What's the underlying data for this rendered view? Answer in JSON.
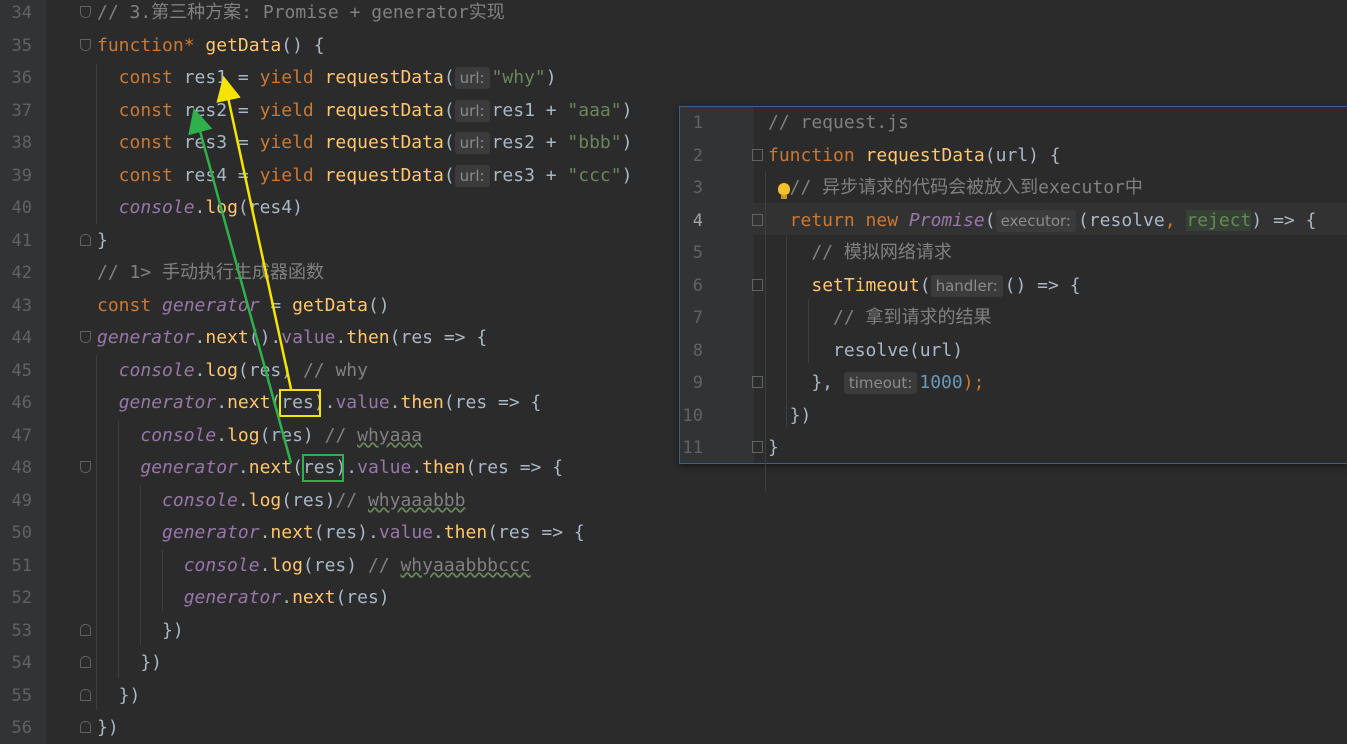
{
  "main_editor": {
    "lines": [
      {
        "num": "34",
        "tokens": [
          {
            "t": "// 3.第三种方案: Promise + generator实现",
            "c": "cm"
          }
        ]
      },
      {
        "num": "35",
        "tokens": [
          {
            "t": "function",
            "c": "kw"
          },
          {
            "t": "* ",
            "c": "kw"
          },
          {
            "t": "getData",
            "c": "fn"
          },
          {
            "t": "() {",
            "c": ""
          }
        ]
      },
      {
        "num": "36",
        "tokens": [
          {
            "t": "  const ",
            "c": "kw"
          },
          {
            "t": "res1 = ",
            "c": ""
          },
          {
            "t": "yield ",
            "c": "kw"
          },
          {
            "t": "requestData",
            "c": "fn"
          },
          {
            "t": "(",
            "c": ""
          },
          {
            "h": "url:"
          },
          {
            "t": "\"why\"",
            "c": "str"
          },
          {
            "t": ")",
            "c": ""
          }
        ]
      },
      {
        "num": "37",
        "tokens": [
          {
            "t": "  const ",
            "c": "kw"
          },
          {
            "t": "res2 = ",
            "c": ""
          },
          {
            "t": "yield ",
            "c": "kw"
          },
          {
            "t": "requestData",
            "c": "fn"
          },
          {
            "t": "(",
            "c": ""
          },
          {
            "h": "url:"
          },
          {
            "t": "res1 + ",
            "c": ""
          },
          {
            "t": "\"aaa\"",
            "c": "str"
          },
          {
            "t": ")",
            "c": ""
          }
        ]
      },
      {
        "num": "38",
        "tokens": [
          {
            "t": "  const ",
            "c": "kw"
          },
          {
            "t": "res3 = ",
            "c": ""
          },
          {
            "t": "yield ",
            "c": "kw"
          },
          {
            "t": "requestData",
            "c": "fn"
          },
          {
            "t": "(",
            "c": ""
          },
          {
            "h": "url:"
          },
          {
            "t": "res2 + ",
            "c": ""
          },
          {
            "t": "\"bbb\"",
            "c": "str"
          },
          {
            "t": ")",
            "c": ""
          }
        ]
      },
      {
        "num": "39",
        "tokens": [
          {
            "t": "  const ",
            "c": "kw"
          },
          {
            "t": "res4 = ",
            "c": ""
          },
          {
            "t": "yield ",
            "c": "kw"
          },
          {
            "t": "requestData",
            "c": "fn"
          },
          {
            "t": "(",
            "c": ""
          },
          {
            "h": "url:"
          },
          {
            "t": "res3 + ",
            "c": ""
          },
          {
            "t": "\"ccc\"",
            "c": "str"
          },
          {
            "t": ")",
            "c": ""
          }
        ]
      },
      {
        "num": "40",
        "tokens": [
          {
            "t": "  ",
            "c": ""
          },
          {
            "t": "console",
            "c": "ital"
          },
          {
            "t": ".",
            "c": ""
          },
          {
            "t": "log",
            "c": "fn"
          },
          {
            "t": "(res4)",
            "c": ""
          }
        ]
      },
      {
        "num": "41",
        "tokens": [
          {
            "t": "}",
            "c": ""
          }
        ]
      },
      {
        "num": "42",
        "tokens": [
          {
            "t": "// 1> 手动执行生成器函数",
            "c": "cm"
          }
        ]
      },
      {
        "num": "43",
        "tokens": [
          {
            "t": "const ",
            "c": "kw"
          },
          {
            "t": "generator",
            "c": "ital"
          },
          {
            "t": " = ",
            "c": ""
          },
          {
            "t": "getData",
            "c": "fn"
          },
          {
            "t": "()",
            "c": ""
          }
        ]
      },
      {
        "num": "44",
        "tokens": [
          {
            "t": "generator",
            "c": "ital"
          },
          {
            "t": ".",
            "c": ""
          },
          {
            "t": "next",
            "c": "fn"
          },
          {
            "t": "().",
            "c": ""
          },
          {
            "t": "value",
            "c": "prop"
          },
          {
            "t": ".",
            "c": ""
          },
          {
            "t": "then",
            "c": "fn"
          },
          {
            "t": "(res => {",
            "c": ""
          }
        ]
      },
      {
        "num": "45",
        "tokens": [
          {
            "t": "  ",
            "c": ""
          },
          {
            "t": "console",
            "c": "ital"
          },
          {
            "t": ".",
            "c": ""
          },
          {
            "t": "log",
            "c": "fn"
          },
          {
            "t": "(res) ",
            "c": ""
          },
          {
            "t": "// why",
            "c": "cm"
          }
        ]
      },
      {
        "num": "46",
        "tokens": [
          {
            "t": "  ",
            "c": ""
          },
          {
            "t": "generator",
            "c": "ital"
          },
          {
            "t": ".",
            "c": ""
          },
          {
            "t": "next",
            "c": "fn"
          },
          {
            "t": "(res).",
            "c": ""
          },
          {
            "t": "value",
            "c": "prop"
          },
          {
            "t": ".",
            "c": ""
          },
          {
            "t": "then",
            "c": "fn"
          },
          {
            "t": "(res => {",
            "c": ""
          }
        ]
      },
      {
        "num": "47",
        "tokens": [
          {
            "t": "    ",
            "c": ""
          },
          {
            "t": "console",
            "c": "ital"
          },
          {
            "t": ".",
            "c": ""
          },
          {
            "t": "log",
            "c": "fn"
          },
          {
            "t": "(res) ",
            "c": ""
          },
          {
            "t": "// ",
            "c": "cm"
          },
          {
            "t": "whyaaa",
            "c": "cm squig"
          }
        ]
      },
      {
        "num": "48",
        "tokens": [
          {
            "t": "    ",
            "c": ""
          },
          {
            "t": "generator",
            "c": "ital"
          },
          {
            "t": ".",
            "c": ""
          },
          {
            "t": "next",
            "c": "fn"
          },
          {
            "t": "(res).",
            "c": ""
          },
          {
            "t": "value",
            "c": "prop"
          },
          {
            "t": ".",
            "c": ""
          },
          {
            "t": "then",
            "c": "fn"
          },
          {
            "t": "(res => {",
            "c": ""
          }
        ]
      },
      {
        "num": "49",
        "tokens": [
          {
            "t": "      ",
            "c": ""
          },
          {
            "t": "console",
            "c": "ital"
          },
          {
            "t": ".",
            "c": ""
          },
          {
            "t": "log",
            "c": "fn"
          },
          {
            "t": "(res)",
            "c": ""
          },
          {
            "t": "// ",
            "c": "cm"
          },
          {
            "t": "whyaaabbb",
            "c": "cm squig"
          }
        ]
      },
      {
        "num": "50",
        "tokens": [
          {
            "t": "      ",
            "c": ""
          },
          {
            "t": "generator",
            "c": "ital"
          },
          {
            "t": ".",
            "c": ""
          },
          {
            "t": "next",
            "c": "fn"
          },
          {
            "t": "(res).",
            "c": ""
          },
          {
            "t": "value",
            "c": "prop"
          },
          {
            "t": ".",
            "c": ""
          },
          {
            "t": "then",
            "c": "fn"
          },
          {
            "t": "(res => {",
            "c": ""
          }
        ]
      },
      {
        "num": "51",
        "tokens": [
          {
            "t": "        ",
            "c": ""
          },
          {
            "t": "console",
            "c": "ital"
          },
          {
            "t": ".",
            "c": ""
          },
          {
            "t": "log",
            "c": "fn"
          },
          {
            "t": "(res) ",
            "c": ""
          },
          {
            "t": "// ",
            "c": "cm"
          },
          {
            "t": "whyaaabbbccc",
            "c": "cm squig"
          }
        ]
      },
      {
        "num": "52",
        "tokens": [
          {
            "t": "        ",
            "c": ""
          },
          {
            "t": "generator",
            "c": "ital"
          },
          {
            "t": ".",
            "c": ""
          },
          {
            "t": "next",
            "c": "fn"
          },
          {
            "t": "(res)",
            "c": ""
          }
        ]
      },
      {
        "num": "53",
        "tokens": [
          {
            "t": "      })",
            "c": ""
          }
        ]
      },
      {
        "num": "54",
        "tokens": [
          {
            "t": "    })",
            "c": ""
          }
        ]
      },
      {
        "num": "55",
        "tokens": [
          {
            "t": "  })",
            "c": ""
          }
        ]
      },
      {
        "num": "56",
        "tokens": [
          {
            "t": "})",
            "c": ""
          }
        ]
      }
    ]
  },
  "popup": {
    "lines": [
      {
        "num": "1",
        "tokens": [
          {
            "t": "// request.js",
            "c": "cm"
          }
        ]
      },
      {
        "num": "2",
        "tokens": [
          {
            "t": "function ",
            "c": "kw"
          },
          {
            "t": "requestData",
            "c": "fn"
          },
          {
            "t": "(url) {",
            "c": ""
          }
        ]
      },
      {
        "num": "3",
        "tokens": [
          {
            "t": "  // 异步请求的代码会被放入到executor中",
            "c": "cm"
          }
        ]
      },
      {
        "num": "4",
        "tokens": [
          {
            "t": "  return new ",
            "c": "kw"
          },
          {
            "t": "Promise",
            "c": "ital"
          },
          {
            "t": "(",
            "c": ""
          },
          {
            "h": "executor:"
          },
          {
            "t": "(resolve",
            "c": ""
          },
          {
            "t": ", ",
            "c": "kw"
          },
          {
            "t": "reject",
            "c": "str rejectbg"
          },
          {
            "t": ") => {",
            "c": ""
          }
        ]
      },
      {
        "num": "5",
        "tokens": [
          {
            "t": "    // 模拟网络请求",
            "c": "cm"
          }
        ]
      },
      {
        "num": "6",
        "tokens": [
          {
            "t": "    ",
            "c": ""
          },
          {
            "t": "setTimeout",
            "c": "fn"
          },
          {
            "t": "(",
            "c": ""
          },
          {
            "h": "handler:"
          },
          {
            "t": "() => {",
            "c": ""
          }
        ]
      },
      {
        "num": "7",
        "tokens": [
          {
            "t": "      // 拿到请求的结果",
            "c": "cm"
          }
        ]
      },
      {
        "num": "8",
        "tokens": [
          {
            "t": "      resolve(url)",
            "c": ""
          }
        ]
      },
      {
        "num": "9",
        "tokens": [
          {
            "t": "    }, ",
            "c": ""
          },
          {
            "h": "timeout:"
          },
          {
            "t": "1000",
            "c": "num"
          },
          {
            "t": ");",
            "c": "kw"
          }
        ]
      },
      {
        "num": "10",
        "tokens": [
          {
            "t": "  })",
            "c": ""
          }
        ]
      },
      {
        "num": "11",
        "tokens": [
          {
            "t": "}",
            "c": ""
          }
        ]
      }
    ]
  },
  "colors": {
    "background": "#2b2b2b",
    "keyword": "#cc7832",
    "function": "#ffc66d",
    "string": "#6a8759",
    "comment": "#808080",
    "italic_var": "#9876aa",
    "number": "#6897bb",
    "arrow_yellow": "#f5e400",
    "arrow_green": "#2fb04a"
  }
}
